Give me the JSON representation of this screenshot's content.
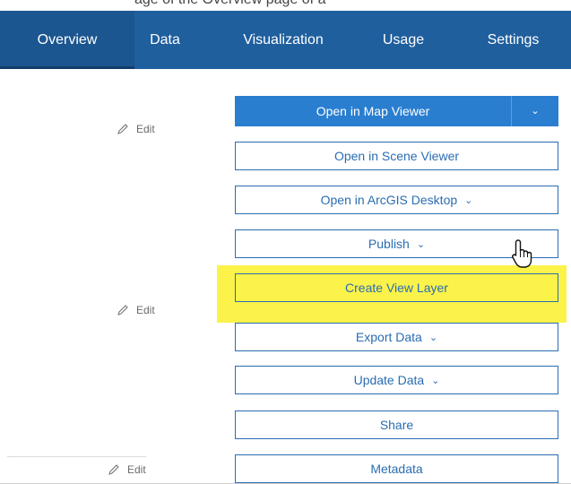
{
  "header_fragment": "age of the Overview page of a",
  "nav": {
    "tabs": [
      {
        "label": "Overview"
      },
      {
        "label": "Data"
      },
      {
        "label": "Visualization"
      },
      {
        "label": "Usage"
      },
      {
        "label": "Settings"
      }
    ],
    "active_index": 0
  },
  "edit_links": [
    {
      "label": "Edit"
    },
    {
      "label": "Edit"
    },
    {
      "label": "Edit"
    }
  ],
  "actions": {
    "primary": {
      "label": "Open in Map Viewer",
      "dropdown_icon": "chevron-down"
    },
    "buttons": [
      {
        "label": "Open in Scene Viewer"
      },
      {
        "label": "Open in ArcGIS Desktop"
      },
      {
        "label": "Publish"
      },
      {
        "label": "Create View Layer"
      },
      {
        "label": "Export Data"
      },
      {
        "label": "Update Data"
      },
      {
        "label": "Share"
      },
      {
        "label": "Metadata"
      }
    ]
  },
  "colors": {
    "nav_bg": "#1f5f9e",
    "primary_blue": "#2a7ed0",
    "highlight": "#fbf24a"
  }
}
